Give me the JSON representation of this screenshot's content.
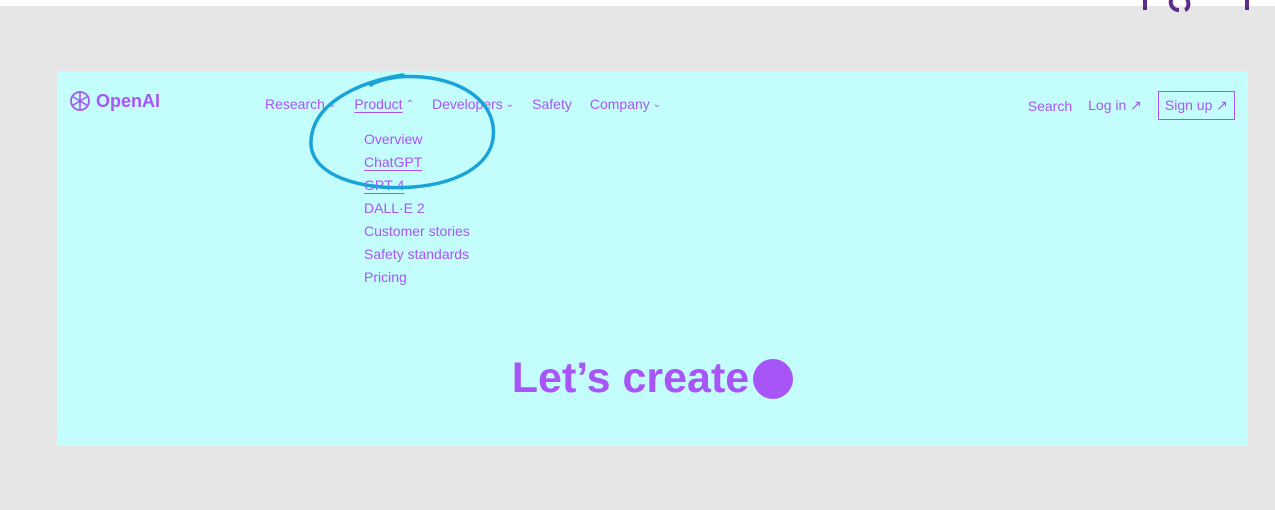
{
  "brand": {
    "name": "OpenAI"
  },
  "nav": {
    "items": [
      {
        "label": "Research",
        "chevron": "⌄"
      },
      {
        "label": "Product",
        "chevron": "⌃"
      },
      {
        "label": "Developers",
        "chevron": "⌄"
      },
      {
        "label": "Safety",
        "chevron": ""
      },
      {
        "label": "Company",
        "chevron": "⌄"
      }
    ]
  },
  "dropdown": {
    "items": [
      "Overview",
      "ChatGPT",
      "GPT-4",
      "DALL·E 2",
      "Customer stories",
      "Safety standards",
      "Pricing"
    ]
  },
  "right_nav": {
    "search": "Search",
    "login": "Log in ↗",
    "signup": "Sign up ↗"
  },
  "hero": {
    "headline": "Let’s create"
  },
  "colors": {
    "panel": "#c4fefc",
    "accent": "#a855f7",
    "annotation": "#1aa3d9",
    "background": "#e6e6e6"
  }
}
